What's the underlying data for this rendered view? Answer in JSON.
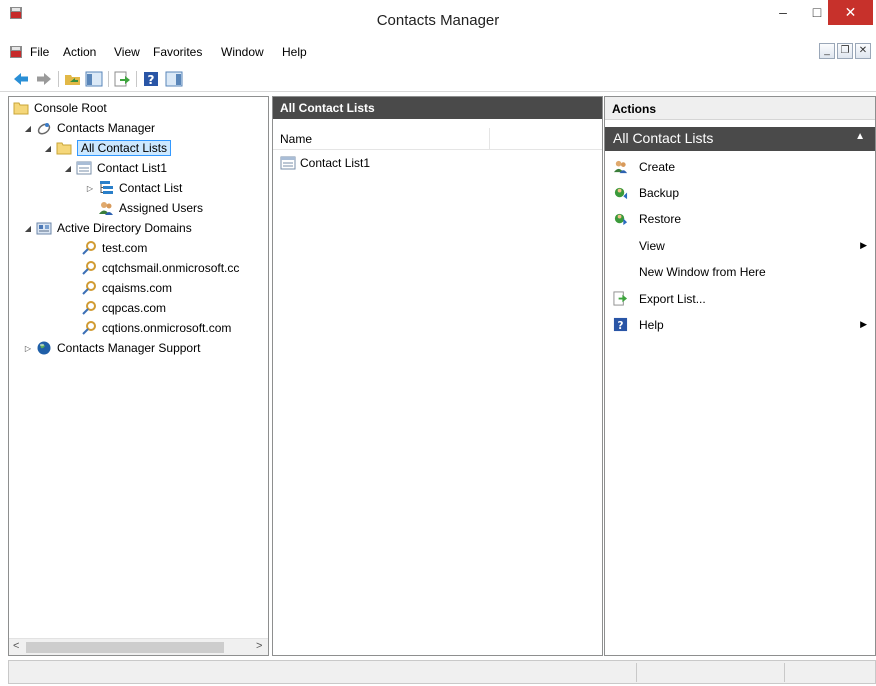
{
  "window": {
    "title": "Contacts Manager",
    "minimize": "–",
    "maximize": "□",
    "close": "✕"
  },
  "menu": [
    "File",
    "Action",
    "View",
    "Favorites",
    "Window",
    "Help"
  ],
  "mdi": {
    "minimize": "_",
    "restore": "❐",
    "close": "✕"
  },
  "tree": {
    "console_root": "Console Root",
    "contacts_manager": "Contacts Manager",
    "all_contact_lists": "All Contact Lists",
    "contact_list1": "Contact List1",
    "contact_list": "Contact List",
    "assigned_users": "Assigned Users",
    "ad_domains": "Active Directory Domains",
    "domains": [
      "test.com",
      "cqtchsmail.onmicrosoft.cc",
      "cqaisms.com",
      "cqpcas.com",
      "cqtions.onmicrosoft.com"
    ],
    "support": "Contacts Manager Support"
  },
  "scroll": {
    "left": "<",
    "right": ">"
  },
  "middle": {
    "title": "All Contact Lists",
    "column_name": "Name",
    "items": [
      "Contact List1"
    ]
  },
  "actions": {
    "header": "Actions",
    "section": "All Contact Lists",
    "items": [
      {
        "label": "Create",
        "icon": "users-icon"
      },
      {
        "label": "Backup",
        "icon": "backup-icon"
      },
      {
        "label": "Restore",
        "icon": "restore-icon"
      },
      {
        "label": "View",
        "icon": ""
      },
      {
        "label": "New Window from Here",
        "icon": ""
      },
      {
        "label": "Export List...",
        "icon": "export-icon"
      },
      {
        "label": "Help",
        "icon": "help-icon"
      }
    ]
  },
  "colors": {
    "header_dark": "#4a4a4a",
    "selection": "#cce8ff",
    "selection_border": "#3399ff",
    "close_red": "#c7312b"
  }
}
